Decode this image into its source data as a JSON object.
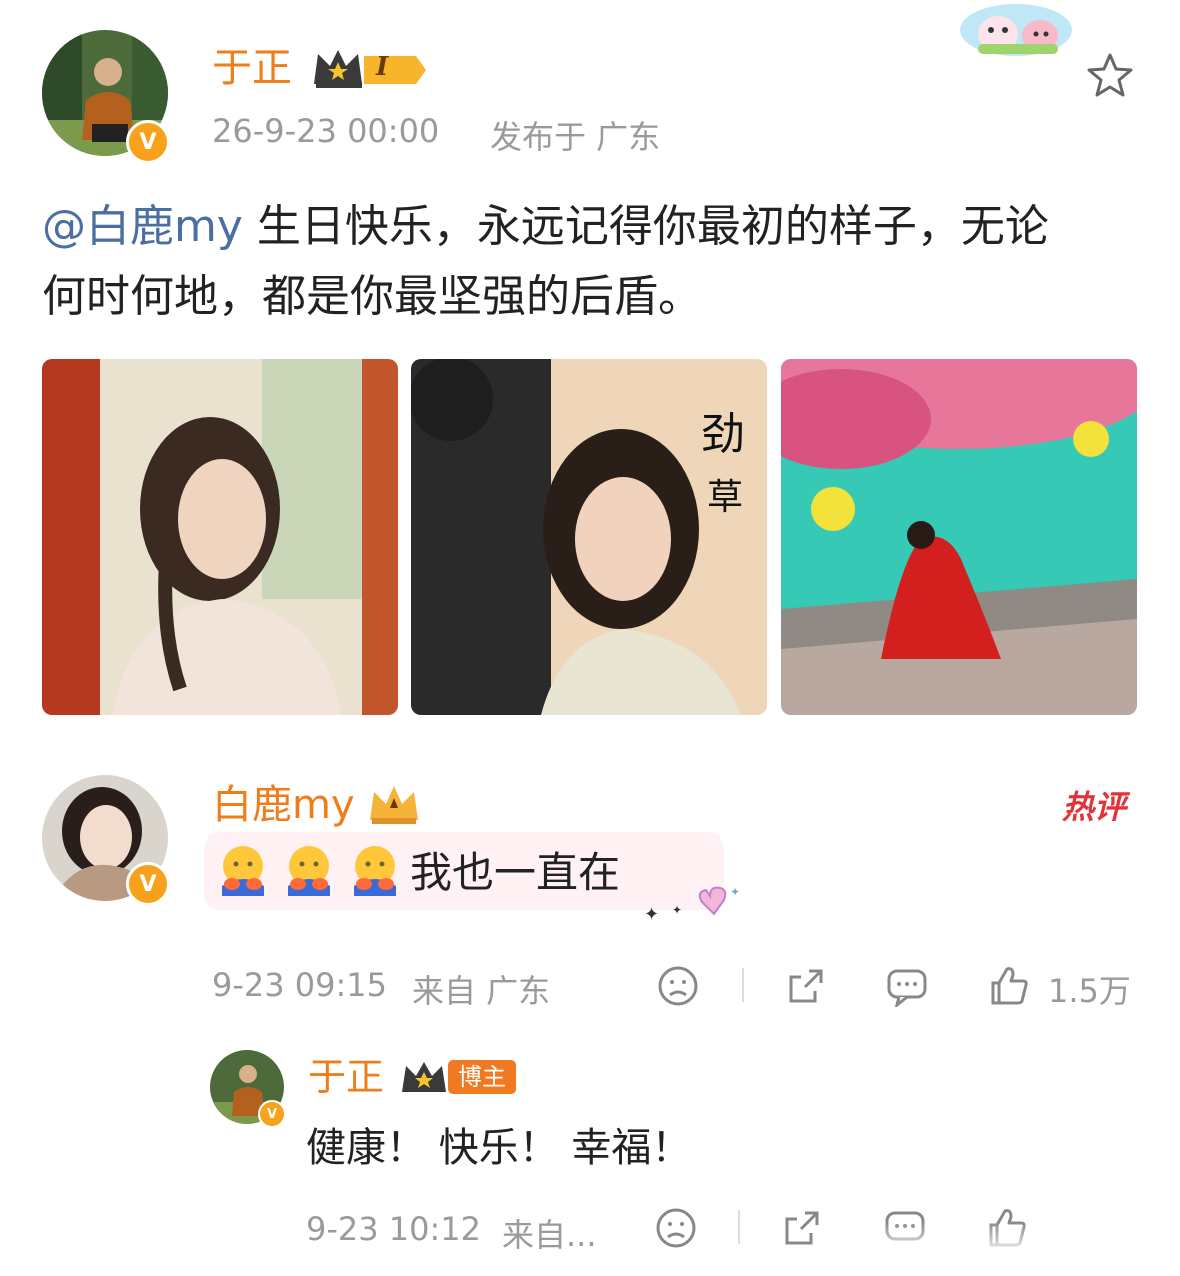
{
  "post": {
    "author": "于正",
    "level_badge": "I",
    "timestamp": "26-9-23 00:00",
    "location": "发布于 广东",
    "mention": "@白鹿my",
    "text_after_mention": " 生日快乐，永远记得你最初的样子，无论",
    "text_line2": "何时何地，都是你最坚强的后盾。"
  },
  "comment": {
    "author": "白鹿my",
    "hot_tag": "热评",
    "text": "我也一直在",
    "timestamp": "9-23 09:15",
    "source": "来自 广东",
    "likes": "1.5万"
  },
  "reply": {
    "author": "于正",
    "role_badge": "博主",
    "text": "健康！ 快乐！ 幸福！",
    "timestamp": "9-23 10:12",
    "source": "来自..."
  },
  "icons": [
    "star-icon",
    "dislike-icon",
    "share-icon",
    "comment-icon",
    "like-icon",
    "crown-icon",
    "verified-icon"
  ],
  "colors": {
    "accent": "#ef7d1a",
    "link": "#4a6fa0",
    "gray": "#9a9a9a",
    "hot": "#e0333a"
  }
}
